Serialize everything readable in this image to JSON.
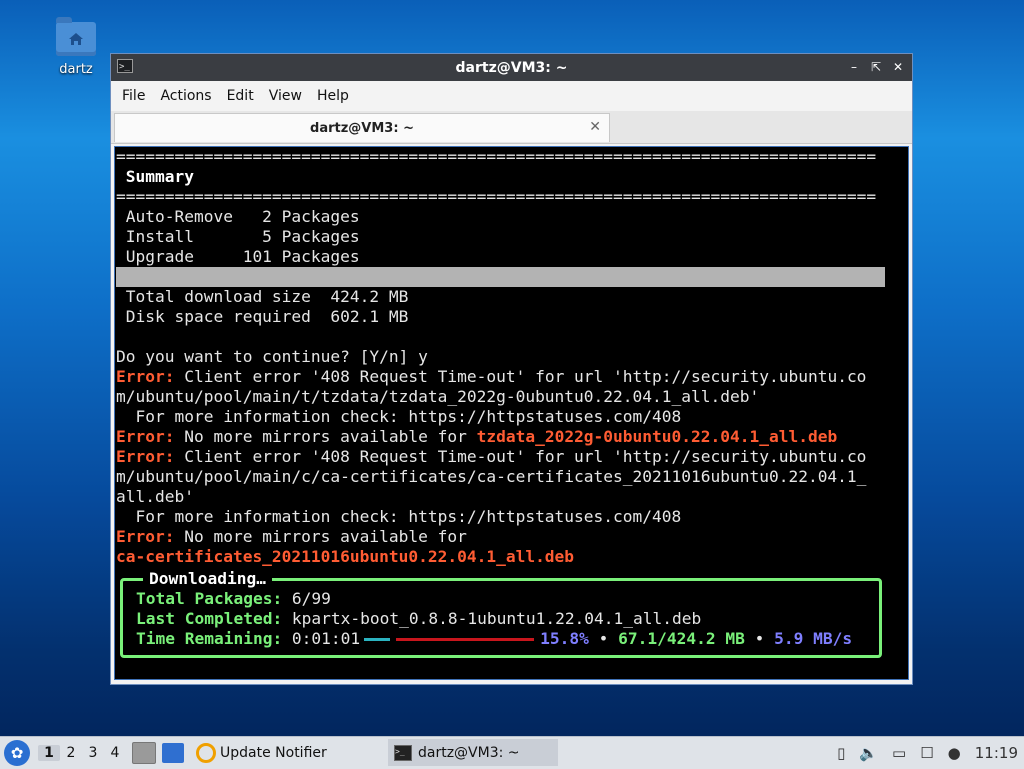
{
  "desktop": {
    "icon_label": "dartz"
  },
  "window": {
    "title": "dartz@VM3: ~",
    "menu": [
      "File",
      "Actions",
      "Edit",
      "View",
      "Help"
    ],
    "tab_title": "dartz@VM3: ~",
    "controls": [
      "minimize-icon",
      "maximize-icon",
      "close-icon"
    ]
  },
  "terminal": {
    "sep": "==============================================================================",
    "summary_title": "Summary",
    "rows": [
      " Auto-Remove   2 Packages",
      " Install       5 Packages",
      " Upgrade     101 Packages"
    ],
    "sizes": [
      " Total download size  424.2 MB",
      " Disk space required  602.1 MB"
    ],
    "prompt": "Do you want to continue? [Y/n] y",
    "error_label": "Error:",
    "err1_a": " Client error '408 Request Time-out' for url 'http://security.ubuntu.co",
    "err1_b": "m/ubuntu/pool/main/t/tzdata/tzdata_2022g-0ubuntu0.22.04.1_all.deb'",
    "info": "  For more information check: https://httpstatuses.com/408",
    "err2_text": " No more mirrors available for ",
    "err2_pkg": "tzdata_2022g-0ubuntu0.22.04.1_all.deb",
    "err3_a": " Client error '408 Request Time-out' for url 'http://security.ubuntu.co",
    "err3_b": "m/ubuntu/pool/main/c/ca-certificates/ca-certificates_20211016ubuntu0.22.04.1_",
    "err3_c": "all.deb'",
    "info2": "  For more information check: https://httpstatuses.com/408",
    "err4_text": " No more mirrors available for",
    "err4_pkg": "ca-certificates_20211016ubuntu0.22.04.1_all.deb",
    "download": {
      "title": "Downloading…",
      "total_label": "Total Packages:",
      "total_value": " 6/99",
      "last_label": "Last Completed:",
      "last_value": " kpartx-boot_0.8.8-1ubuntu1.22.04.1_all.deb",
      "time_label": "Time Remaining:",
      "time_value": " 0:01:01",
      "progress_fraction": 0.158,
      "percent": "15.8%",
      "bullet": " • ",
      "size": "67.1/424.2 MB",
      "speed": "5.9 MB/s"
    }
  },
  "taskbar": {
    "workspaces": [
      "1",
      "2",
      "3",
      "4"
    ],
    "notifier_label": "Update Notifier",
    "task_label": "dartz@VM3: ~",
    "clock": "11:19"
  }
}
